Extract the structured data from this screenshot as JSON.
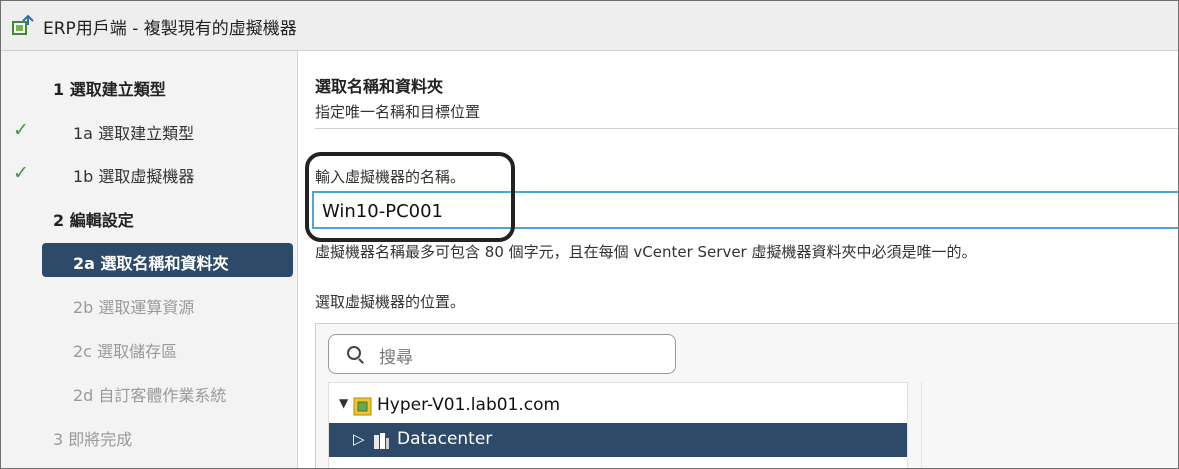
{
  "window": {
    "title": "ERP用戶端 - 複製現有的虛擬機器",
    "icon": "vm-clone-icon"
  },
  "sidebar": {
    "steps": [
      {
        "label": "1  選取建立類型",
        "state": "header"
      },
      {
        "label": "1a  選取建立類型",
        "state": "done"
      },
      {
        "label": "1b  選取虛擬機器",
        "state": "done"
      },
      {
        "label": "2  編輯設定",
        "state": "header"
      },
      {
        "label": "2a  選取名稱和資料夾",
        "state": "current"
      },
      {
        "label": "2b  選取運算資源",
        "state": "disabled"
      },
      {
        "label": "2c  選取儲存區",
        "state": "disabled"
      },
      {
        "label": "2d  自訂客體作業系統",
        "state": "disabled"
      },
      {
        "label": "3  即將完成",
        "state": "disabled"
      }
    ],
    "check_glyph": "✓"
  },
  "main": {
    "section_title": "選取名稱和資料夾",
    "section_subtitle": "指定唯一名稱和目標位置",
    "name_label": "輸入虛擬機器的名稱。",
    "name_value": "Win10-PC001",
    "name_hint": "虛擬機器名稱最多可包含 80 個字元，且在每個 vCenter Server 虛擬機器資料夾中必須是唯一的。",
    "location_label": "選取虛擬機器的位置。",
    "search": {
      "placeholder": "搜尋"
    },
    "tree": [
      {
        "label": "Hyper-V01.lab01.com",
        "expander": "▼",
        "icon": "vcenter-server-icon",
        "selected": false
      },
      {
        "label": "Datacenter",
        "expander": "▷",
        "icon": "datacenter-icon",
        "selected": true
      }
    ]
  },
  "colors": {
    "selected_bg": "#2d4a68",
    "input_border": "#4aa7d6",
    "check": "#3c9a3c",
    "disabled_text": "#9a9a9a"
  }
}
